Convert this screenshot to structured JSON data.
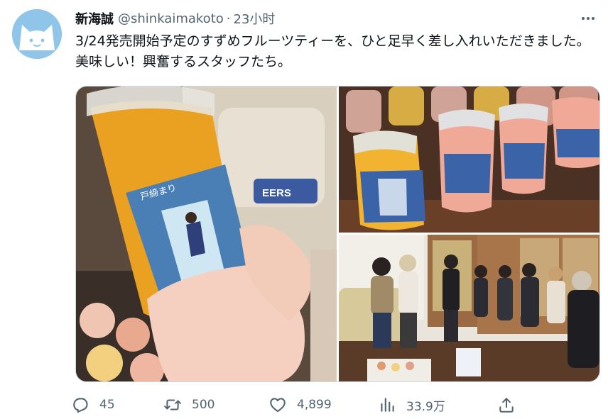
{
  "author": {
    "display_name": "新海誠",
    "handle": "@shinkaimakoto",
    "separator": "·",
    "time": "23小时"
  },
  "tweet": {
    "text": "3/24発売開始予定のすずめフルーツティーを、ひと足早く差し入れいただきました。美味しい！興奮するスタッフたち。"
  },
  "media": {
    "cup_sleeve_text": "戸締まり",
    "sofa_text": "EERS"
  },
  "actions": {
    "reply_count": "45",
    "retweet_count": "500",
    "like_count": "4,899",
    "views_count": "33.9万"
  },
  "colors": {
    "secondary_text": "#536471",
    "avatar_bg": "#8ec5e8",
    "border": "#cfd9de"
  },
  "icons": [
    "cat-face-icon",
    "more-icon",
    "reply-icon",
    "retweet-icon",
    "like-icon",
    "views-icon",
    "share-icon"
  ]
}
